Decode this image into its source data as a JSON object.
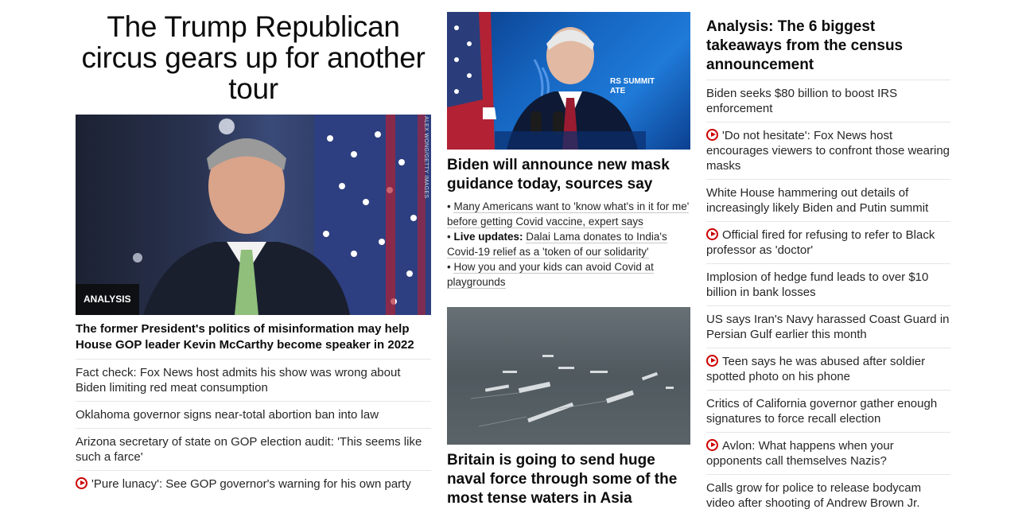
{
  "left": {
    "headline": "The Trump Republican circus gears up for another tour",
    "hero_badge": "ANALYSIS",
    "photo_credit": "ALEX WONG/GETTY IMAGES",
    "hero_title": "The former President's politics of misinformation may help House GOP leader Kevin McCarthy become speaker in 2022",
    "items": [
      {
        "text": "Fact check: Fox News host admits his show was wrong about Biden limiting red meat consumption",
        "video": false
      },
      {
        "text": "Oklahoma governor signs near-total abortion ban into law",
        "video": false
      },
      {
        "text": "Arizona secretary of state on GOP election audit: 'This seems like such a farce'",
        "video": false
      },
      {
        "text": "'Pure lunacy': See GOP governor's warning for his own party",
        "video": true
      }
    ]
  },
  "middle": {
    "image1_sign": "RS SUMMIT",
    "image1_sign2": "ATE",
    "headline1": "Biden will announce new mask guidance today, sources say",
    "bullets": [
      {
        "bold": "",
        "text": "Many Americans want to 'know what's in it for me' before getting Covid vaccine, expert says"
      },
      {
        "bold": "Live updates:",
        "text": "Dalai Lama donates to India's Covid-19 relief as a 'token of our solidarity'"
      },
      {
        "bold": "",
        "text": "How you and your kids can avoid Covid at playgrounds"
      }
    ],
    "headline2": "Britain is going to send huge naval force through some of the most tense waters in Asia"
  },
  "right": {
    "headline": "Analysis: The 6 biggest takeaways from the census announcement",
    "items": [
      {
        "text": "Biden seeks $80 billion to boost IRS enforcement",
        "video": false
      },
      {
        "text": "'Do not hesitate': Fox News host encourages viewers to confront those wearing masks",
        "video": true
      },
      {
        "text": "White House hammering out details of increasingly likely Biden and Putin summit",
        "video": false
      },
      {
        "text": "Official fired for refusing to refer to Black professor as 'doctor'",
        "video": true
      },
      {
        "text": "Implosion of hedge fund leads to over $10 billion in bank losses",
        "video": false
      },
      {
        "text": "US says Iran's Navy harassed Coast Guard in Persian Gulf earlier this month",
        "video": false
      },
      {
        "text": "Teen says he was abused after soldier spotted photo on his phone",
        "video": true
      },
      {
        "text": "Critics of California governor gather enough signatures to force recall election",
        "video": false
      },
      {
        "text": "Avlon: What happens when your opponents call themselves Nazis?",
        "video": true
      },
      {
        "text": "Calls grow for police to release bodycam video after shooting of Andrew Brown Jr.",
        "video": false
      }
    ]
  },
  "colors": {
    "video_icon": "#cc0000",
    "badge_bg": "#0c0c0c",
    "divider": "#e6e6e6"
  }
}
